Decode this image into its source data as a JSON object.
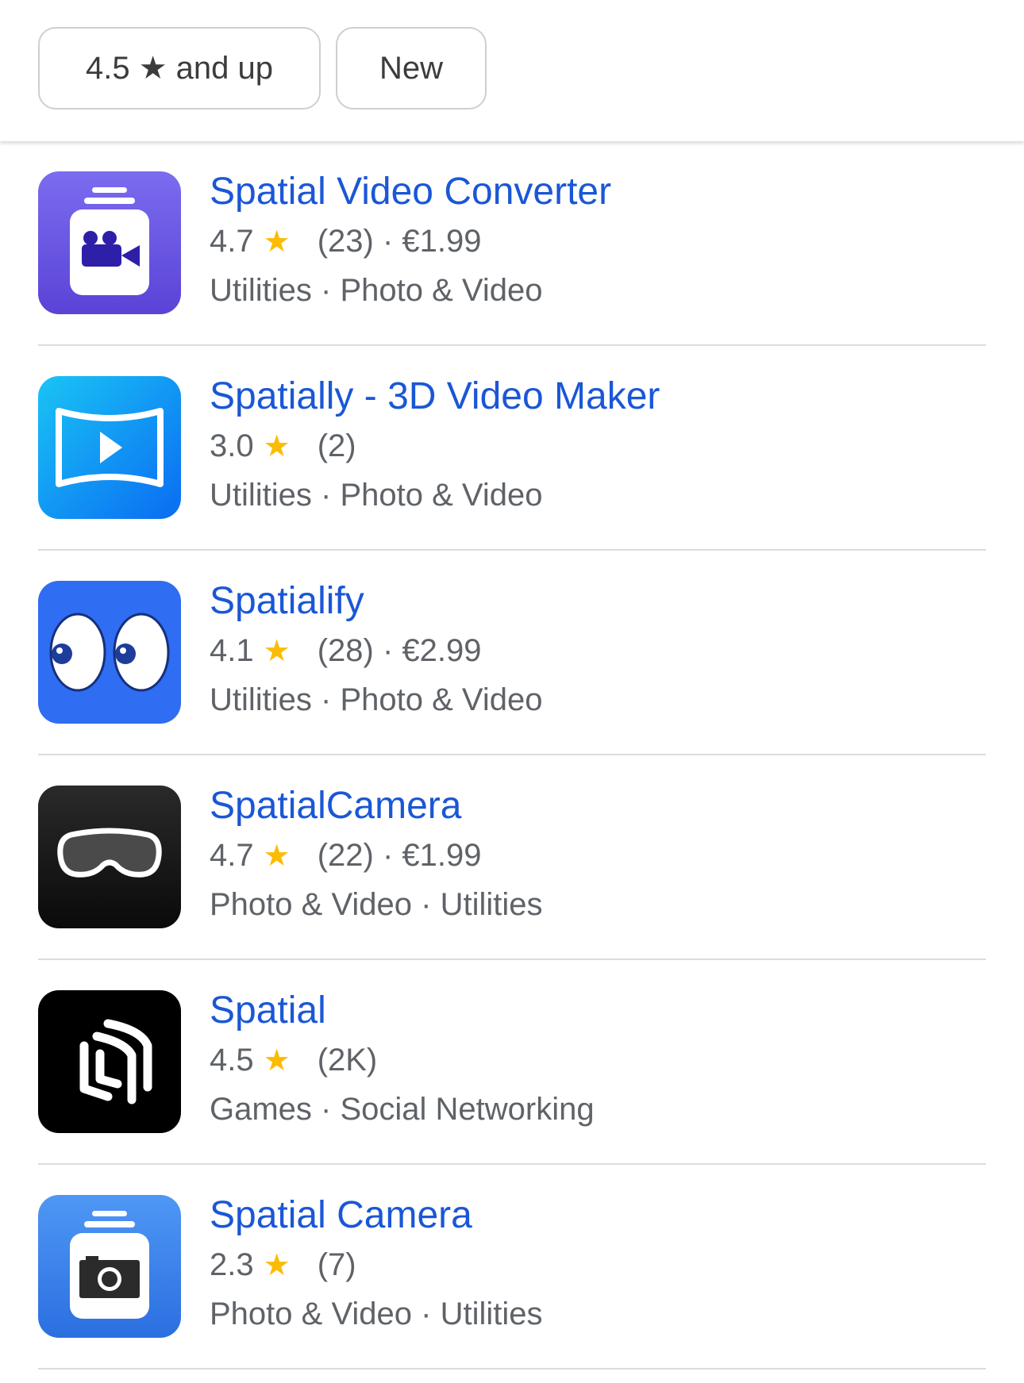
{
  "filters": {
    "rating_chip": "4.5 ★ and up",
    "new_chip": "New"
  },
  "apps": [
    {
      "name": "Spatial Video Converter",
      "rating": "4.7",
      "reviews": "(23)",
      "price": "€1.99",
      "categories": "Utilities · Photo & Video",
      "icon": "video-camera-icon"
    },
    {
      "name": "Spatially - 3D Video Maker",
      "rating": "3.0",
      "reviews": "(2)",
      "price": "",
      "categories": "Utilities · Photo & Video",
      "icon": "panorama-play-icon"
    },
    {
      "name": "Spatialify",
      "rating": "4.1",
      "reviews": "(28)",
      "price": "€2.99",
      "categories": "Utilities · Photo & Video",
      "icon": "eyes-icon"
    },
    {
      "name": "SpatialCamera",
      "rating": "4.7",
      "reviews": "(22)",
      "price": "€1.99",
      "categories": "Photo & Video · Utilities",
      "icon": "headset-icon"
    },
    {
      "name": "Spatial",
      "rating": "4.5",
      "reviews": "(2K)",
      "price": "",
      "categories": "Games · Social Networking",
      "icon": "spatial-logo-icon"
    },
    {
      "name": "Spatial Camera",
      "rating": "2.3",
      "reviews": "(7)",
      "price": "",
      "categories": "Photo & Video · Utilities",
      "icon": "photo-camera-icon"
    }
  ],
  "colors": {
    "title_link": "#1a57d6",
    "star": "#fbbc04",
    "secondary_text": "#5f6368"
  }
}
